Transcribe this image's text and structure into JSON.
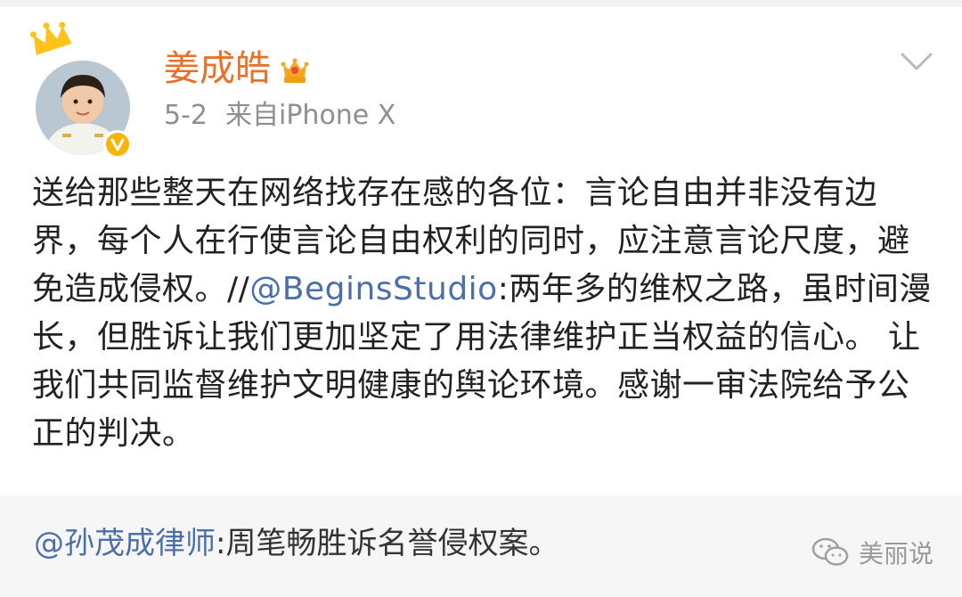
{
  "author": {
    "name": "姜成皓",
    "date": "5-2",
    "source": "来自iPhone X",
    "name_color": "#e8702a",
    "verified_color": "#f7b500"
  },
  "icons": [
    "crown-icon",
    "avatar",
    "verified-icon",
    "vip-icon",
    "chevron-down-icon",
    "wechat-icon"
  ],
  "post": {
    "text_before_mention": "送给那些整天在网络找存在感的各位：言论自由并非没有边界，每个人在行使言论自由权利的同时，应注意言论尺度，避免造成侵权。//",
    "mention": "@BeginsStudio",
    "text_after_mention": ":两年多的维权之路，虽时间漫长，但胜诉让我们更加坚定了用法律维护正当权益的信心。 让我们共同监督维护文明健康的舆论环境。感谢一审法院给予公正的判决。",
    "mention_color": "#4d6fa8"
  },
  "retweet": {
    "mention": "@孙茂成律师",
    "text": ":周笔畅胜诉名誉侵权案。"
  },
  "watermark": {
    "text": "美丽说"
  }
}
